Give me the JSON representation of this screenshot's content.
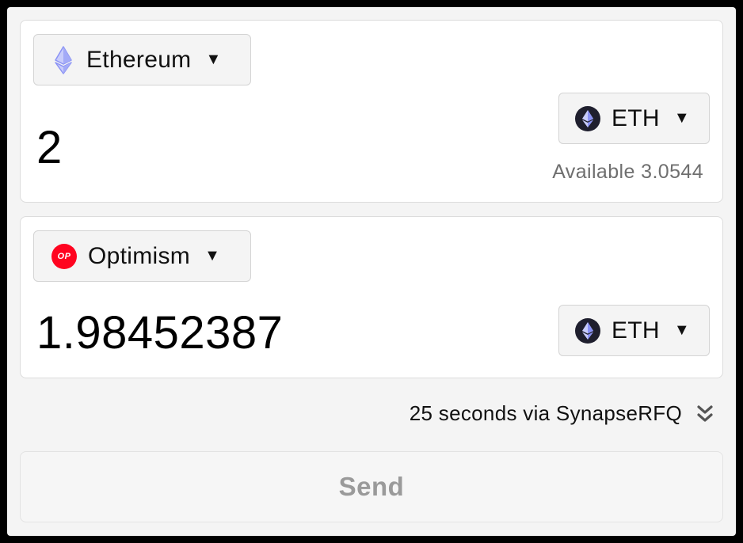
{
  "from": {
    "chain": {
      "label": "Ethereum",
      "icon": "ethereum-icon"
    },
    "token": {
      "label": "ETH",
      "icon": "eth-token-icon"
    },
    "amount": "2",
    "available": "Available 3.0544"
  },
  "to": {
    "chain": {
      "label": "Optimism",
      "icon": "optimism-icon",
      "badge": "OP"
    },
    "token": {
      "label": "ETH",
      "icon": "eth-token-icon"
    },
    "amount": "1.98452387"
  },
  "route": {
    "text": "25 seconds via SynapseRFQ",
    "icon": "double-chevron-down-icon"
  },
  "send": {
    "label": "Send"
  },
  "caret": "▼",
  "colors": {
    "background": "#f4f4f4",
    "card": "#ffffff",
    "optimism_red": "#ff0420",
    "ethereum_purple": "#8a92f5",
    "disabled_text": "#9a9a9a"
  }
}
